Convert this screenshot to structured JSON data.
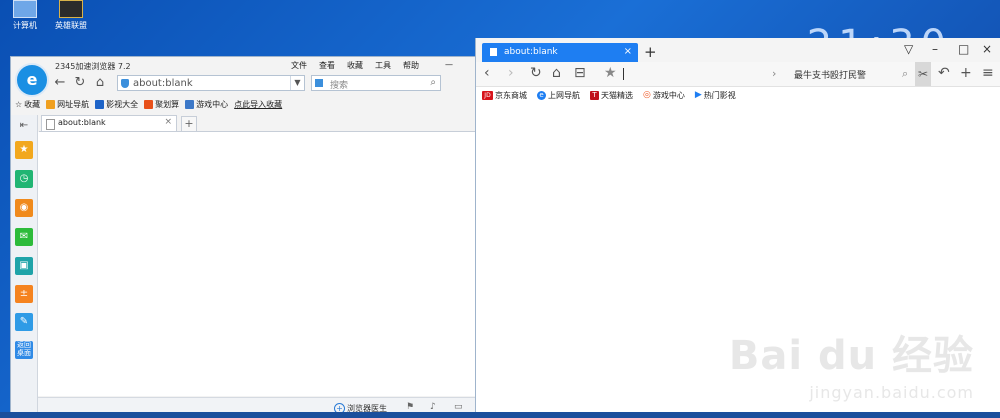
{
  "desktop": {
    "icons": [
      {
        "label": "计算机"
      },
      {
        "label": "英雄联盟"
      }
    ],
    "clock_partial": "21:30"
  },
  "left_browser": {
    "title": "2345加速浏览器 7.2",
    "menus": [
      "文件",
      "查看",
      "收藏",
      "工具",
      "帮助"
    ],
    "nav": {
      "back": "←",
      "reload": "↻",
      "home": "⌂"
    },
    "address": "about:blank",
    "search_placeholder": "搜索",
    "bookmarks": [
      {
        "label": "收藏",
        "color": "#777777"
      },
      {
        "label": "网址导航",
        "color": "#f0a020"
      },
      {
        "label": "影视大全",
        "color": "#1e64c8"
      },
      {
        "label": "聚划算",
        "color": "#e8501a"
      },
      {
        "label": "游戏中心",
        "color": "#3c78c8"
      },
      {
        "label": "点此导入收藏",
        "color": "#333333"
      }
    ],
    "tab": {
      "title": "about:blank",
      "close": "×"
    },
    "new_tab": "+",
    "sidebar_colors": [
      "#f2a81e",
      "#21b573",
      "#f08a1c",
      "#2dbb3a",
      "#1fa3a8",
      "#f5831f",
      "#2f9be6",
      "#2f8ae6"
    ],
    "sidebar_bottom_label": "返回桌面",
    "status": {
      "doctor": "浏览器医生"
    }
  },
  "right_browser": {
    "tab": {
      "title": "about:blank",
      "close": "×"
    },
    "new_tab": "+",
    "window_controls": {
      "min": "–",
      "max": "□",
      "close": "×"
    },
    "search_text": "最牛支书殴打民警",
    "bookmarks": [
      {
        "label": "京东商城",
        "color": "#d7141c",
        "glyph": "JD"
      },
      {
        "label": "上网导航",
        "color": "#1e7ef2",
        "glyph": "e"
      },
      {
        "label": "天猫精选",
        "color": "#c0101a",
        "glyph": "T"
      },
      {
        "label": "游戏中心",
        "color": "#f05a28",
        "glyph": "◎"
      },
      {
        "label": "热门影视",
        "color": "#1e7ef2",
        "glyph": "▶"
      }
    ]
  },
  "watermark": {
    "brand": "Bai du 经验",
    "url": "jingyan.baidu.com"
  }
}
